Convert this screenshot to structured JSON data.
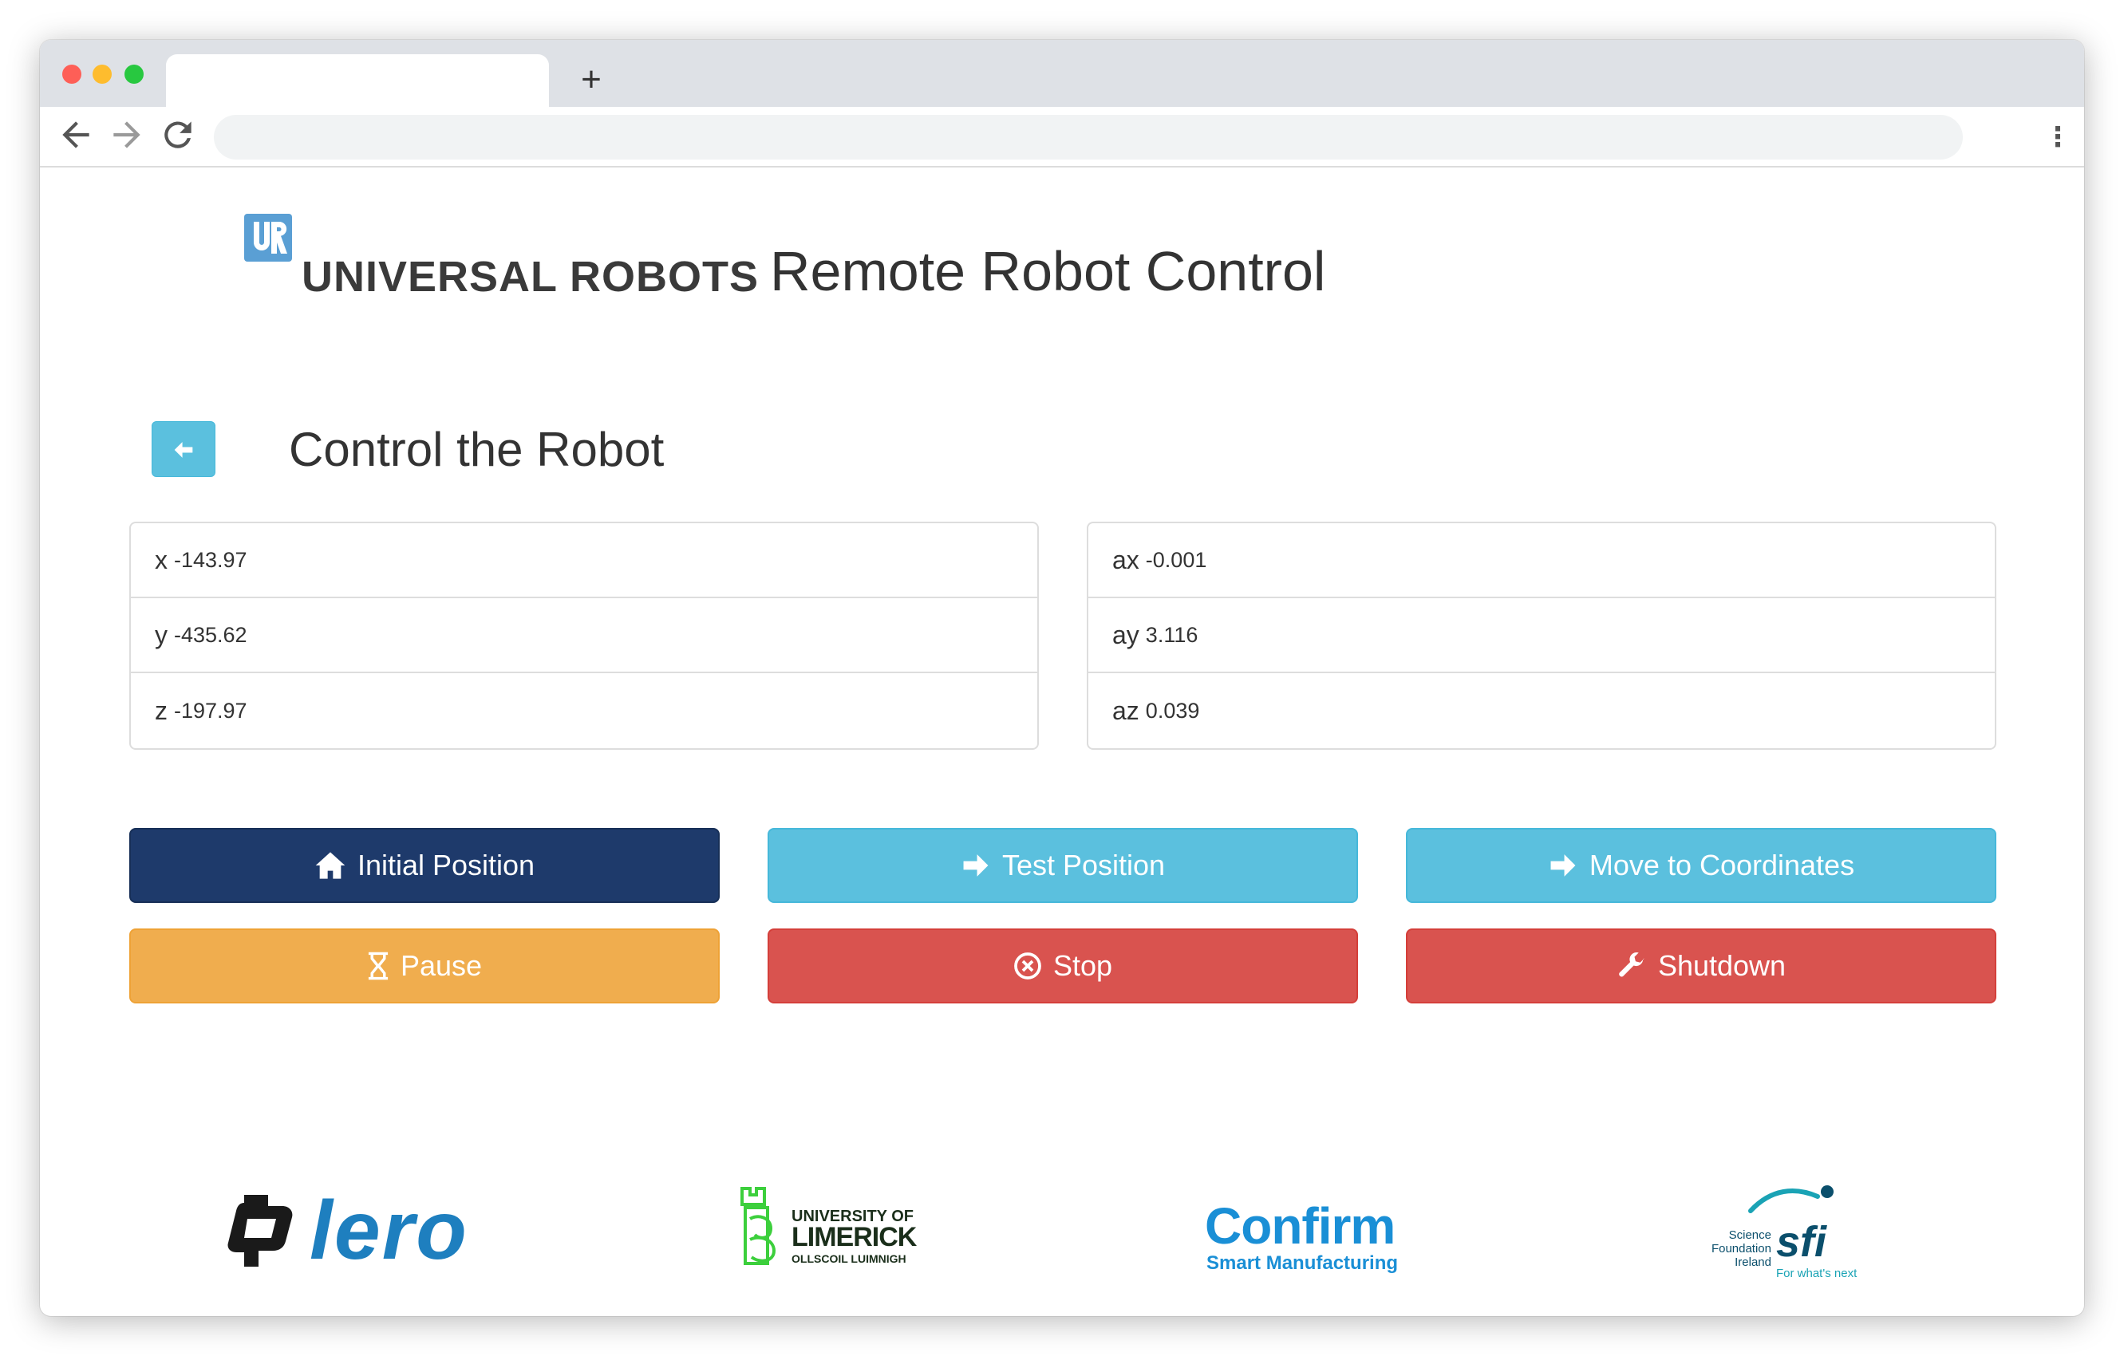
{
  "browser": {
    "new_tab_symbol": "+",
    "menu_symbol": "⋮"
  },
  "header": {
    "logo_text": "UNIVERSAL ROBOTS",
    "title": "Remote Robot Control"
  },
  "section": {
    "title": "Control the Robot"
  },
  "coordinates": {
    "left": [
      {
        "label": "x",
        "value": "-143.97"
      },
      {
        "label": "y",
        "value": "-435.62"
      },
      {
        "label": "z",
        "value": "-197.97"
      }
    ],
    "right": [
      {
        "label": "ax",
        "value": "-0.001"
      },
      {
        "label": "ay",
        "value": "3.116"
      },
      {
        "label": "az",
        "value": "0.039"
      }
    ]
  },
  "actions": {
    "initial_position": "Initial Position",
    "test_position": "Test Position",
    "move_to_coordinates": "Move to Coordinates",
    "pause": "Pause",
    "stop": "Stop",
    "shutdown": "Shutdown"
  },
  "partners": {
    "lero": "lero",
    "limerick_line1": "UNIVERSITY OF",
    "limerick_line2": "LIMERICK",
    "limerick_line3": "OLLSCOIL LUIMNIGH",
    "confirm": "Confirm",
    "confirm_sub": "Smart Manufacturing",
    "sfi_org": "Science Foundation Ireland",
    "sfi_mark": "sfi",
    "sfi_tagline": "For what's next"
  },
  "colors": {
    "primary": "#1e3a6b",
    "info": "#5bc0de",
    "warning": "#f0ad4e",
    "danger": "#d9534f"
  }
}
